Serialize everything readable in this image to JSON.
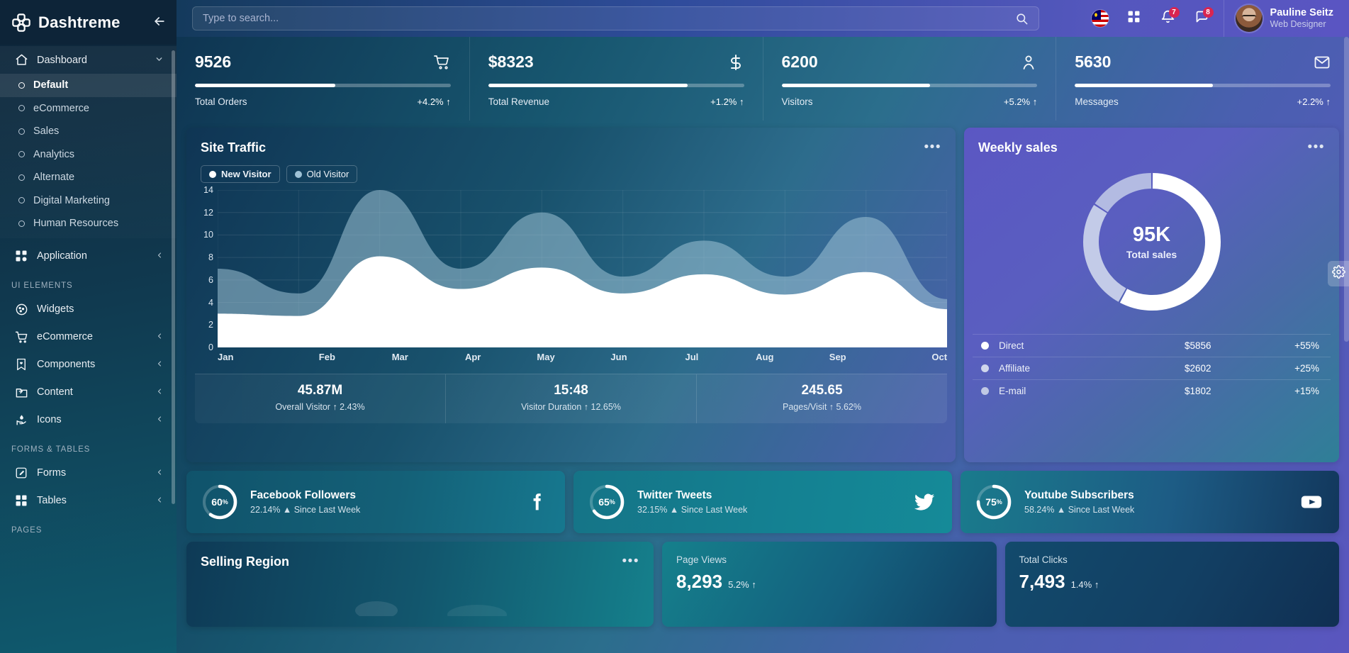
{
  "brand": {
    "name": "Dashtreme",
    "logo_icon": "cross-grid-logo-icon",
    "collapse_icon": "arrow-left-icon"
  },
  "sidebar": {
    "dashboard": {
      "label": "Dashboard",
      "icon": "home-icon",
      "chevron": "chevron-down-icon"
    },
    "dashboard_items": [
      {
        "label": "Default",
        "active": true
      },
      {
        "label": "eCommerce",
        "active": false
      },
      {
        "label": "Sales",
        "active": false
      },
      {
        "label": "Analytics",
        "active": false
      },
      {
        "label": "Alternate",
        "active": false
      },
      {
        "label": "Digital Marketing",
        "active": false
      },
      {
        "label": "Human Resources",
        "active": false
      }
    ],
    "application": {
      "label": "Application",
      "icon": "grid-apps-icon",
      "chevron": "chevron-left-icon"
    },
    "section_ui": "UI ELEMENTS",
    "ui_items": [
      {
        "label": "Widgets",
        "icon": "cookie-icon",
        "chevron": ""
      },
      {
        "label": "eCommerce",
        "icon": "shopping-cart-icon",
        "chevron": "chevron-left-icon"
      },
      {
        "label": "Components",
        "icon": "bookmark-heart-icon",
        "chevron": "chevron-left-icon"
      },
      {
        "label": "Content",
        "icon": "folder-share-icon",
        "chevron": "chevron-left-icon"
      },
      {
        "label": "Icons",
        "icon": "hand-drop-icon",
        "chevron": "chevron-left-icon"
      }
    ],
    "section_forms": "FORMS & TABLES",
    "forms_items": [
      {
        "label": "Forms",
        "icon": "edit-square-icon",
        "chevron": "chevron-left-icon"
      },
      {
        "label": "Tables",
        "icon": "grid-squares-icon",
        "chevron": "chevron-left-icon"
      }
    ],
    "section_pages": "PAGES"
  },
  "topbar": {
    "search_placeholder": "Type to search...",
    "search_value": "",
    "search_icon": "search-icon",
    "flag_icon": "malaysia-flag-icon",
    "apps_icon": "grid-apps-icon",
    "bell_icon": "bell-icon",
    "bell_badge": "7",
    "chat_icon": "chat-bubble-icon",
    "chat_badge": "8",
    "user_name": "Pauline Seitz",
    "user_role": "Web Designer",
    "settings_icon": "gear-icon"
  },
  "kpis": [
    {
      "value": "9526",
      "label": "Total Orders",
      "delta": "+4.2%",
      "arrow": "↑",
      "progress": 55,
      "icon": "shopping-cart-icon"
    },
    {
      "value": "$8323",
      "label": "Total Revenue",
      "delta": "+1.2%",
      "arrow": "↑",
      "progress": 78,
      "icon": "dollar-icon"
    },
    {
      "value": "6200",
      "label": "Visitors",
      "delta": "+5.2%",
      "arrow": "↑",
      "progress": 58,
      "icon": "user-icon"
    },
    {
      "value": "5630",
      "label": "Messages",
      "delta": "+2.2%",
      "arrow": "↑",
      "progress": 54,
      "icon": "envelope-icon"
    }
  ],
  "site_traffic": {
    "title": "Site Traffic",
    "menu_icon": "more-options-icon",
    "legend": [
      {
        "label": "New Visitor",
        "color": "#ffffff"
      },
      {
        "label": "Old Visitor",
        "color": "#9fc2d6"
      }
    ],
    "stats": [
      {
        "value": "45.87M",
        "label": "Overall Visitor",
        "arrow": "↑",
        "delta": "2.43%"
      },
      {
        "value": "15:48",
        "label": "Visitor Duration",
        "arrow": "↑",
        "delta": "12.65%"
      },
      {
        "value": "245.65",
        "label": "Pages/Visit",
        "arrow": "↑",
        "delta": "5.62%"
      }
    ]
  },
  "chart_data": {
    "type": "area",
    "title": "Site Traffic",
    "xlabel": "",
    "ylabel": "",
    "ylim": [
      0,
      14
    ],
    "yticks": [
      0,
      2,
      4,
      6,
      8,
      10,
      12,
      14
    ],
    "grid": true,
    "legend_position": "top-left",
    "categories": [
      "Jan",
      "Feb",
      "Mar",
      "Apr",
      "May",
      "Jun",
      "Jul",
      "Aug",
      "Sep",
      "Oct"
    ],
    "series": [
      {
        "name": "New Visitor",
        "color": "#ffffff",
        "values": [
          3.0,
          2.8,
          8.1,
          5.2,
          7.1,
          4.8,
          6.5,
          4.7,
          6.7,
          3.4
        ]
      },
      {
        "name": "Old Visitor",
        "color": "#9fc2d6",
        "values": [
          7.0,
          4.8,
          14.0,
          7.0,
          12.0,
          6.3,
          9.5,
          6.3,
          11.6,
          4.3
        ]
      }
    ]
  },
  "weekly_sales": {
    "title": "Weekly sales",
    "menu_icon": "more-options-icon",
    "center_value": "95K",
    "center_label": "Total sales",
    "donut": {
      "type": "pie",
      "slices": [
        {
          "name": "Direct",
          "value": 55,
          "color": "#ffffff"
        },
        {
          "name": "Affiliate",
          "value": 25,
          "color": "#c3cbe8"
        },
        {
          "name": "E-mail",
          "value": 15,
          "color": "#b3bbe2"
        }
      ]
    },
    "rows": [
      {
        "name": "Direct",
        "amount": "$5856",
        "pct": "+55%",
        "color": "#ffffff"
      },
      {
        "name": "Affiliate",
        "amount": "$2602",
        "pct": "+25%",
        "color": "#cfd6ec"
      },
      {
        "name": "E-mail",
        "amount": "$1802",
        "pct": "+15%",
        "color": "#c0c8e4"
      }
    ]
  },
  "social": [
    {
      "pct": "60",
      "pct_suffix": "%",
      "value": 60,
      "title": "Facebook Followers",
      "sub": "22.14% ▲ Since Last Week",
      "icon": "facebook-icon"
    },
    {
      "pct": "65",
      "pct_suffix": "%",
      "value": 65,
      "title": "Twitter Tweets",
      "sub": "32.15% ▲ Since Last Week",
      "icon": "twitter-icon"
    },
    {
      "pct": "75",
      "pct_suffix": "%",
      "value": 75,
      "title": "Youtube Subscribers",
      "sub": "58.24% ▲ Since Last Week",
      "icon": "youtube-icon"
    }
  ],
  "selling_region": {
    "title": "Selling Region",
    "menu_icon": "more-options-icon"
  },
  "page_views": {
    "label": "Page Views",
    "value": "8,293",
    "delta": "5.2%",
    "arrow": "↑"
  },
  "total_clicks": {
    "label": "Total Clicks",
    "value": "7,493",
    "delta": "1.4%",
    "arrow": "↑"
  }
}
